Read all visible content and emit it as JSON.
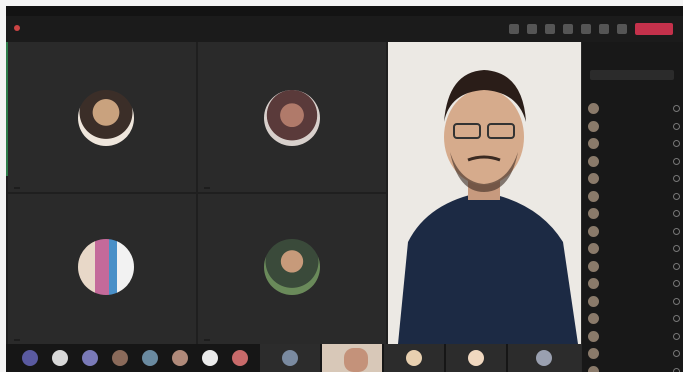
{
  "window": {
    "title": ""
  },
  "toolbar": {
    "meeting_label": "",
    "leave_label": ""
  },
  "tiles": [
    {
      "name": ""
    },
    {
      "name": ""
    },
    {
      "name": ""
    },
    {
      "name": ""
    }
  ],
  "speaker": {
    "name": ""
  },
  "participants_panel": {
    "title": "",
    "search_placeholder": "",
    "section_label": "",
    "people": [
      "",
      "",
      "",
      "",
      "",
      "",
      "",
      "",
      "",
      "",
      "",
      "",
      "",
      "",
      "",
      ""
    ]
  },
  "colors": {
    "accent": "#c4314b",
    "panel_bg": "#181818",
    "tile_bg": "#2a2a2a",
    "green_strip": "#2e7d4a"
  }
}
